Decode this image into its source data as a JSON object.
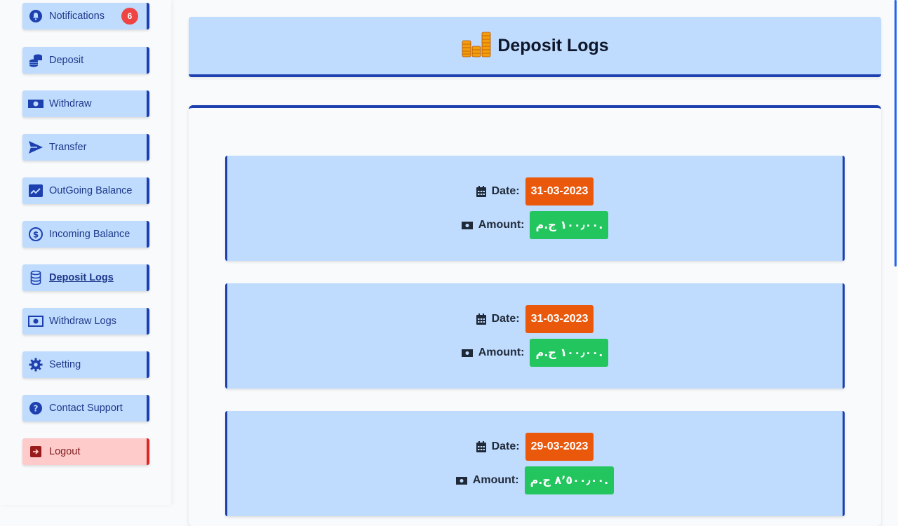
{
  "sidebar": {
    "items": [
      {
        "label": "Notifications",
        "icon": "bell-icon",
        "badge": "6"
      },
      {
        "label": "Deposit",
        "icon": "coins-stack-icon"
      },
      {
        "label": "Withdraw",
        "icon": "money-bill-icon"
      },
      {
        "label": "Transfer",
        "icon": "paper-plane-icon"
      },
      {
        "label": "OutGoing Balance",
        "icon": "chart-line-icon"
      },
      {
        "label": "Incoming Balance",
        "icon": "dollar-circle-icon"
      },
      {
        "label": "Deposit Logs",
        "icon": "database-icon",
        "active": true
      },
      {
        "label": "Withdraw Logs",
        "icon": "money-bill-icon"
      },
      {
        "label": "Setting",
        "icon": "gear-icon"
      },
      {
        "label": "Contact Support",
        "icon": "question-circle-icon"
      },
      {
        "label": "Logout",
        "icon": "logout-icon"
      }
    ]
  },
  "header": {
    "title": "Deposit Logs",
    "icon": "coins-icon"
  },
  "logs": [
    {
      "date_label": "Date:",
      "date": "31-03-2023",
      "amount_label": "Amount:",
      "amount": "١٠٠٫٠٠ ج.م."
    },
    {
      "date_label": "Date:",
      "date": "31-03-2023",
      "amount_label": "Amount:",
      "amount": "١٠٠٫٠٠ ج.م."
    },
    {
      "date_label": "Date:",
      "date": "29-03-2023",
      "amount_label": "Amount:",
      "amount": "٨٬٥٠٠٫٠٠ ج.م."
    }
  ],
  "colors": {
    "accent": "#1e40af",
    "card_bg": "#bfdbfe",
    "date_pill": "#ea580c",
    "amount_pill": "#22c55e",
    "badge": "#ef4444",
    "logout_bg": "#fecaca"
  }
}
